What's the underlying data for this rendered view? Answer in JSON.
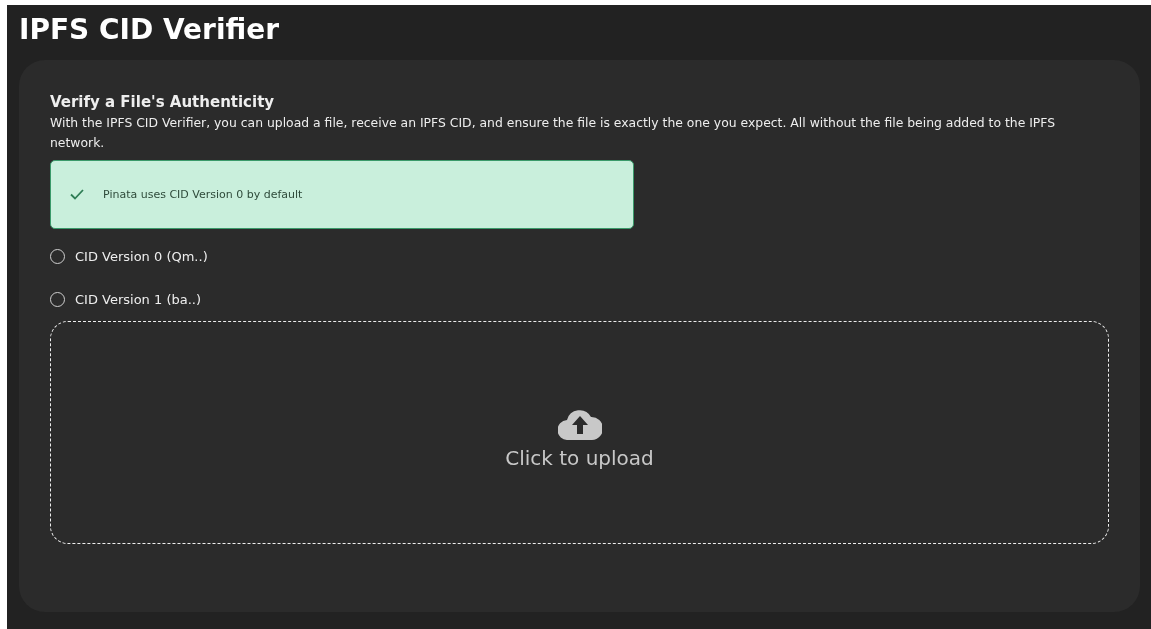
{
  "page": {
    "title": "IPFS CID Verifier"
  },
  "card": {
    "heading": "Verify a File's Authenticity",
    "description": "With the IPFS CID Verifier, you can upload a file, receive an IPFS CID, and ensure the file is exactly the one you expect. All without the file being added to the IPFS network."
  },
  "alert": {
    "kind": "success",
    "text": "Pinata uses CID Version 0 by default"
  },
  "cid_versions": [
    {
      "label": "CID Version 0 (Qm..)",
      "selected": false
    },
    {
      "label": "CID Version 1 (ba..)",
      "selected": false
    }
  ],
  "upload": {
    "label": "Click to upload"
  }
}
